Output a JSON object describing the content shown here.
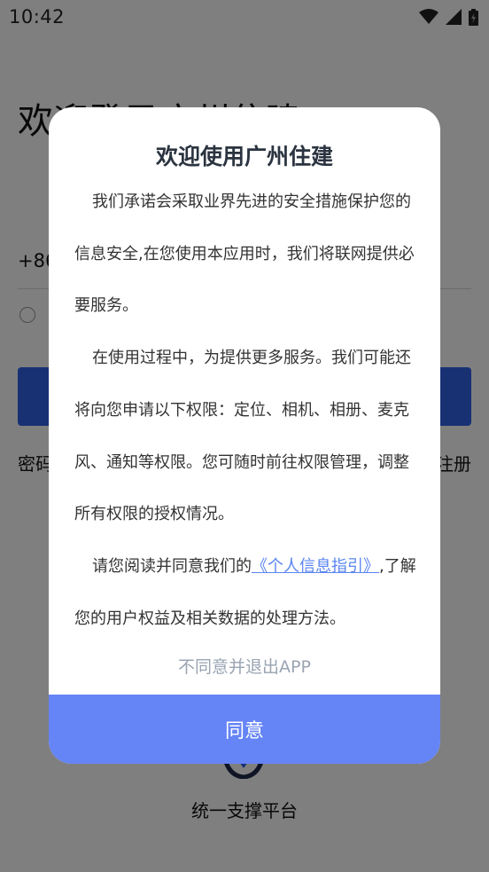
{
  "status_bar": {
    "time": "10:42"
  },
  "login": {
    "welcome_title": "欢迎登录广州住建",
    "phone_prefix": "+86",
    "password_login": "密码",
    "register": "注册",
    "platform_name": "统一支撑平台"
  },
  "dialog": {
    "title": "欢迎使用广州住建",
    "para1": "我们承诺会采取业界先进的安全措施保护您的信息安全,在您使用本应用时，我们将联网提供必要服务。",
    "para2": "在使用过程中，为提供更多服务。我们可能还将向您申请以下权限：定位、相机、相册、麦克风、通知等权限。您可随时前往权限管理，调整所有权限的授权情况。",
    "para3_prefix": "请您阅读并同意我们的",
    "privacy_link": "《个人信息指引》",
    "para3_suffix": ",了解您的用户权益及相关数据的处理方法。",
    "decline_label": "不同意并退出APP",
    "agree_label": "同意"
  },
  "colors": {
    "accent": "#6584f5",
    "login_button": "#2f62e6",
    "link": "#5a84f0"
  }
}
